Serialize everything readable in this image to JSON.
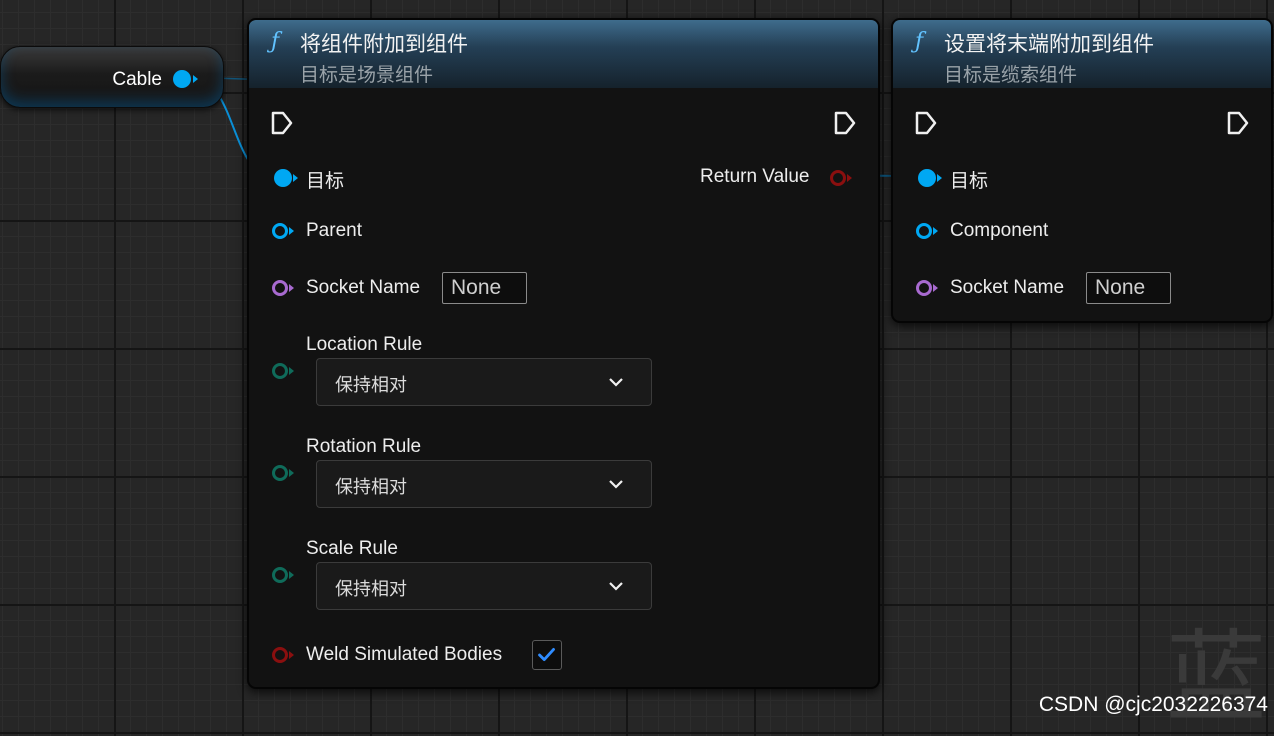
{
  "variable_node": {
    "label": "Cable"
  },
  "attach_node": {
    "title": "将组件附加到组件",
    "subtitle": "目标是场景组件",
    "icon": "function-icon",
    "target_label": "目标",
    "return_label": "Return Value",
    "parent_label": "Parent",
    "socket_label": "Socket Name",
    "socket_value": "None",
    "location_rule_label": "Location Rule",
    "location_rule_value": "保持相对",
    "rotation_rule_label": "Rotation Rule",
    "rotation_rule_value": "保持相对",
    "scale_rule_label": "Scale Rule",
    "scale_rule_value": "保持相对",
    "weld_label": "Weld Simulated Bodies",
    "weld_checked": true
  },
  "set_end_node": {
    "title": "设置将末端附加到组件",
    "subtitle": "目标是缆索组件",
    "icon": "function-icon",
    "target_label": "目标",
    "component_label": "Component",
    "socket_label": "Socket Name",
    "socket_value": "None"
  },
  "colors": {
    "object_pin": "#00a8f3",
    "name_pin": "#a86ad0",
    "enum_pin": "#0f6b5a",
    "bool_pin": "#8a0f0f",
    "header_top": "#3f6c8c",
    "check_accent": "#2f8cff"
  },
  "background_glyph": "蓝",
  "watermark": "CSDN @cjc2032226374"
}
